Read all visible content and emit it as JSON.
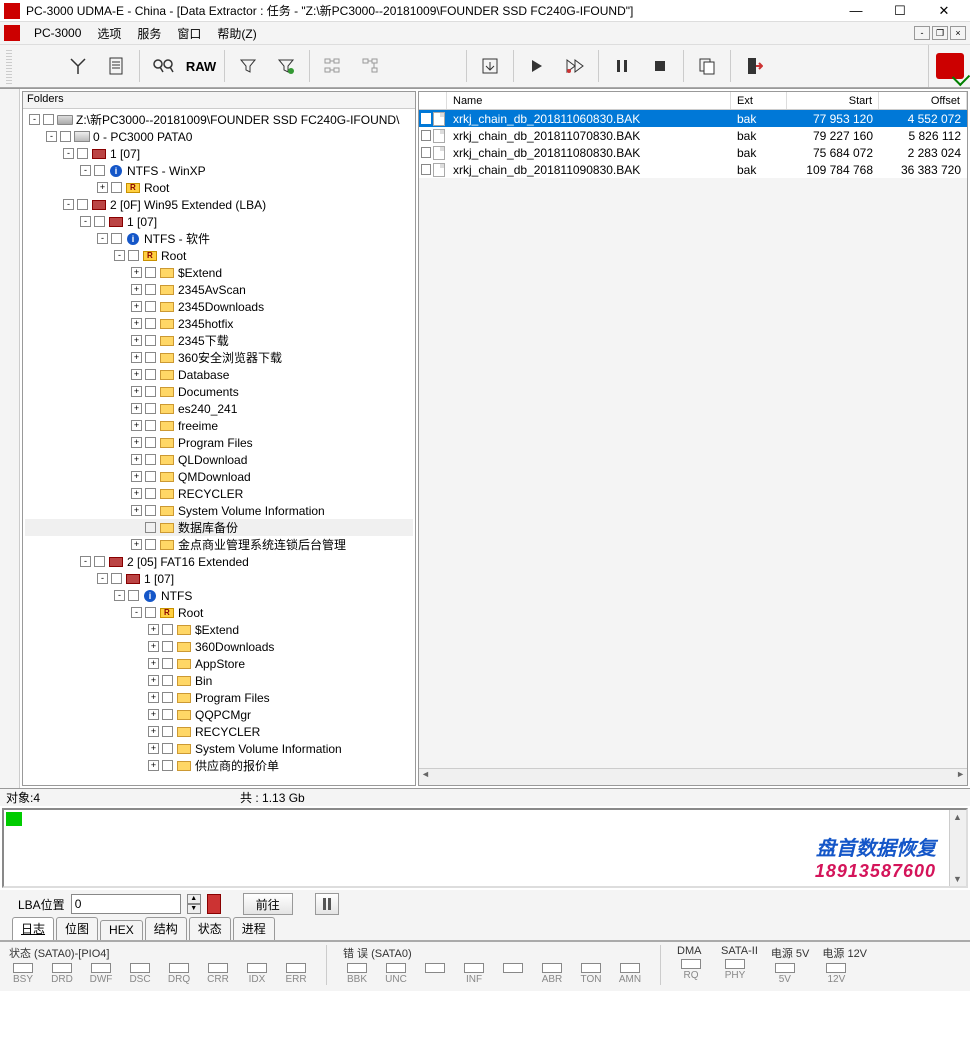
{
  "titlebar": {
    "title": "PC-3000 UDMA-E - China - [Data Extractor : 任务 - \"Z:\\新PC3000--20181009\\FOUNDER SSD FC240G-IFOUND\"]"
  },
  "menubar": {
    "app": "PC-3000",
    "items": [
      "选项",
      "服务",
      "窗口",
      "帮助(Z)"
    ]
  },
  "toolbar": {
    "buttons": [
      "tools",
      "doc",
      "search",
      "raw",
      "filter",
      "filter2",
      "tree1",
      "tree2",
      "export",
      "play",
      "skip",
      "pause",
      "stop",
      "copy",
      "exit"
    ]
  },
  "leftpane": {
    "header": "Folders"
  },
  "tree": [
    {
      "indent": 0,
      "exp": "-",
      "chk": true,
      "icon": "drive",
      "label": "Z:\\新PC3000--20181009\\FOUNDER SSD FC240G-IFOUND\\"
    },
    {
      "indent": 1,
      "exp": "-",
      "chk": true,
      "icon": "disk",
      "label": "0 - PC3000 PATA0"
    },
    {
      "indent": 2,
      "exp": "-",
      "chk": true,
      "icon": "part",
      "label": "1 [07]"
    },
    {
      "indent": 3,
      "exp": "-",
      "chk": true,
      "icon": "ntfs",
      "label": "NTFS - WinXP"
    },
    {
      "indent": 4,
      "exp": "+",
      "chk": true,
      "icon": "root",
      "label": "Root"
    },
    {
      "indent": 2,
      "exp": "-",
      "chk": true,
      "icon": "part",
      "label": "2 [0F] Win95 Extended  (LBA)"
    },
    {
      "indent": 3,
      "exp": "-",
      "chk": true,
      "icon": "part",
      "label": "1 [07]"
    },
    {
      "indent": 4,
      "exp": "-",
      "chk": true,
      "icon": "ntfs",
      "label": "NTFS - 软件"
    },
    {
      "indent": 5,
      "exp": "-",
      "chk": true,
      "icon": "root",
      "label": "Root"
    },
    {
      "indent": 6,
      "exp": "+",
      "chk": true,
      "icon": "folder",
      "label": "$Extend"
    },
    {
      "indent": 6,
      "exp": "+",
      "chk": true,
      "icon": "folder",
      "label": "2345AvScan"
    },
    {
      "indent": 6,
      "exp": "+",
      "chk": true,
      "icon": "folder",
      "label": "2345Downloads"
    },
    {
      "indent": 6,
      "exp": "+",
      "chk": true,
      "icon": "folder",
      "label": "2345hotfix"
    },
    {
      "indent": 6,
      "exp": "+",
      "chk": true,
      "icon": "folder",
      "label": "2345下载"
    },
    {
      "indent": 6,
      "exp": "+",
      "chk": true,
      "icon": "folder",
      "label": "360安全浏览器下载"
    },
    {
      "indent": 6,
      "exp": "+",
      "chk": true,
      "icon": "folder",
      "label": "Database"
    },
    {
      "indent": 6,
      "exp": "+",
      "chk": true,
      "icon": "folder",
      "label": "Documents"
    },
    {
      "indent": 6,
      "exp": "+",
      "chk": true,
      "icon": "folder",
      "label": "es240_241"
    },
    {
      "indent": 6,
      "exp": "+",
      "chk": true,
      "icon": "folder",
      "label": "freeime"
    },
    {
      "indent": 6,
      "exp": "+",
      "chk": true,
      "icon": "folder",
      "label": "Program Files"
    },
    {
      "indent": 6,
      "exp": "+",
      "chk": true,
      "icon": "folder",
      "label": "QLDownload"
    },
    {
      "indent": 6,
      "exp": "+",
      "chk": true,
      "icon": "folder",
      "label": "QMDownload"
    },
    {
      "indent": 6,
      "exp": "+",
      "chk": true,
      "icon": "folder",
      "label": "RECYCLER"
    },
    {
      "indent": 6,
      "exp": "+",
      "chk": true,
      "icon": "folder",
      "label": "System Volume Information"
    },
    {
      "indent": 6,
      "exp": " ",
      "chk": true,
      "icon": "folder",
      "label": "数据库备份",
      "selected": true
    },
    {
      "indent": 6,
      "exp": "+",
      "chk": true,
      "icon": "folder",
      "label": "金点商业管理系统连锁后台管理"
    },
    {
      "indent": 3,
      "exp": "-",
      "chk": true,
      "icon": "part",
      "label": "2 [05] FAT16 Extended"
    },
    {
      "indent": 4,
      "exp": "-",
      "chk": true,
      "icon": "part",
      "label": "1 [07]"
    },
    {
      "indent": 5,
      "exp": "-",
      "chk": true,
      "icon": "ntfs",
      "label": "NTFS"
    },
    {
      "indent": 6,
      "exp": "-",
      "chk": true,
      "icon": "root",
      "label": "Root"
    },
    {
      "indent": 7,
      "exp": "+",
      "chk": true,
      "icon": "folder",
      "label": "$Extend"
    },
    {
      "indent": 7,
      "exp": "+",
      "chk": true,
      "icon": "folder",
      "label": "360Downloads"
    },
    {
      "indent": 7,
      "exp": "+",
      "chk": true,
      "icon": "folder",
      "label": "AppStore"
    },
    {
      "indent": 7,
      "exp": "+",
      "chk": true,
      "icon": "folder",
      "label": "Bin"
    },
    {
      "indent": 7,
      "exp": "+",
      "chk": true,
      "icon": "folder",
      "label": "Program Files"
    },
    {
      "indent": 7,
      "exp": "+",
      "chk": true,
      "icon": "folder",
      "label": "QQPCMgr"
    },
    {
      "indent": 7,
      "exp": "+",
      "chk": true,
      "icon": "folder",
      "label": "RECYCLER"
    },
    {
      "indent": 7,
      "exp": "+",
      "chk": true,
      "icon": "folder",
      "label": "System Volume Information"
    },
    {
      "indent": 7,
      "exp": "+",
      "chk": true,
      "icon": "folder",
      "label": "供应商的报价单"
    }
  ],
  "filelist": {
    "columns": {
      "name": "Name",
      "ext": "Ext",
      "start": "Start",
      "offset": "Offset"
    },
    "rows": [
      {
        "name": "xrkj_chain_db_201811060830.BAK",
        "ext": "bak",
        "start": "77 953 120",
        "offset": "4 552 072",
        "selected": true
      },
      {
        "name": "xrkj_chain_db_201811070830.BAK",
        "ext": "bak",
        "start": "79 227 160",
        "offset": "5 826 112"
      },
      {
        "name": "xrkj_chain_db_201811080830.BAK",
        "ext": "bak",
        "start": "75 684 072",
        "offset": "2 283 024"
      },
      {
        "name": "xrkj_chain_db_201811090830.BAK",
        "ext": "bak",
        "start": "109 784 768",
        "offset": "36 383 720"
      }
    ]
  },
  "status": {
    "objects": "对象:4",
    "total": "共 :  1.13 Gb"
  },
  "watermark": {
    "line1": "盘首数据恢复",
    "line2": "18913587600"
  },
  "lba": {
    "label": "LBA位置",
    "value": "0",
    "go": "前往"
  },
  "tabs": [
    "日志",
    "位图",
    "HEX",
    "结构",
    "状态",
    "进程"
  ],
  "bottom": {
    "g1_title": "状态 (SATA0)-[PIO4]",
    "g1": [
      "BSY",
      "DRD",
      "DWF",
      "DSC",
      "DRQ",
      "CRR",
      "IDX",
      "ERR"
    ],
    "g2_title": "错 误 (SATA0)",
    "g2": [
      "BBK",
      "UNC",
      "",
      "INF",
      "",
      "ABR",
      "TON",
      "AMN"
    ],
    "g3_title": "DMA",
    "g3": [
      "RQ"
    ],
    "g4_title": "SATA-II",
    "g4": [
      "PHY"
    ],
    "g5_title": "电源 5V",
    "g5": [
      "5V"
    ],
    "g6_title": "电源 12V",
    "g6": [
      "12V"
    ]
  }
}
